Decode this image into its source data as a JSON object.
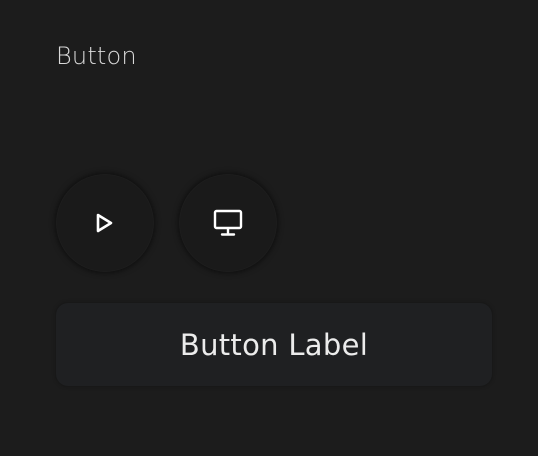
{
  "section": {
    "title": "Button"
  },
  "icon_buttons": [
    {
      "icon": "play-icon"
    },
    {
      "icon": "monitor-icon"
    }
  ],
  "label_button": {
    "label": "Button Label"
  },
  "colors": {
    "background": "#1c1c1c",
    "button_surface": "#1f2022",
    "icon": "#ffffff",
    "text": "#ececec"
  }
}
